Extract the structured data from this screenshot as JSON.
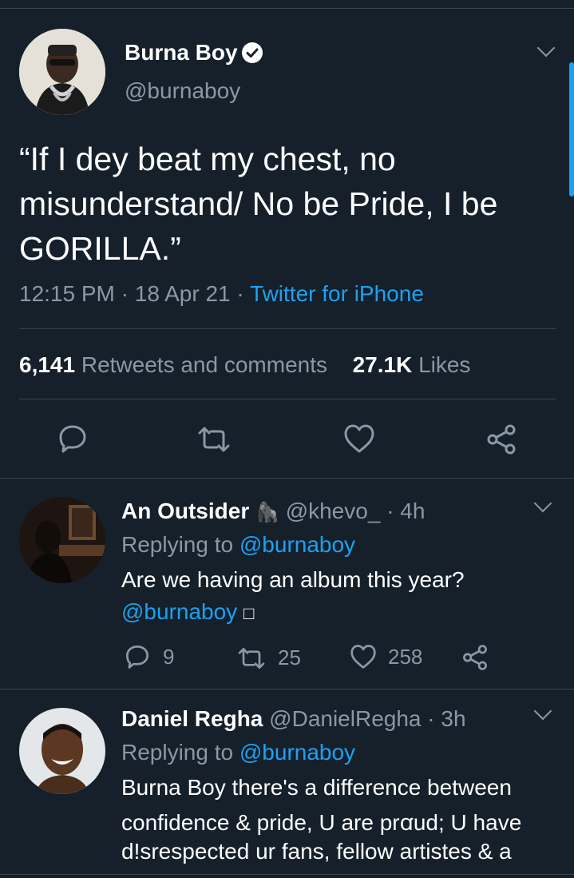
{
  "main_tweet": {
    "author_name": "Burna Boy",
    "author_handle": "@burnaboy",
    "text_line1": "“If I dey beat my chest, no",
    "text_line2": "misunderstand/ No be Pride, I be",
    "text_line3": "GORILLA.”",
    "time": "12:15 PM",
    "date": "18 Apr 21",
    "source": "Twitter for iPhone",
    "sep": "·",
    "retweets_count": "6,141",
    "retweets_label": "Retweets and comments",
    "likes_count": "27.1K",
    "likes_label": "Likes"
  },
  "replies": [
    {
      "name": "An Outsider",
      "emoji": "🦍",
      "handle": "@khevo_",
      "age": "· 4h",
      "replying_prefix": "Replying to",
      "replying_to": "@burnaboy",
      "text_line1": "Are we having an album this year?",
      "text_line2_mention": "@burnaboy",
      "text_line2_rest": "□",
      "reply_count": "9",
      "retweet_count": "25",
      "like_count": "258"
    },
    {
      "name": "Daniel Regha",
      "handle": "@DanielRegha",
      "age": "· 3h",
      "replying_prefix": "Replying to",
      "replying_to": "@burnaboy",
      "text_line1": "Burna Boy there's a difference between",
      "text_line2": "confidence & pride, U are prꭤud; U have",
      "text_line3": "d!srespected ur fans, fellow artistes & a"
    }
  ],
  "colors": {
    "background": "#15202b",
    "accent": "#1da1f2",
    "muted": "#8899a6",
    "divider": "#38444d"
  }
}
